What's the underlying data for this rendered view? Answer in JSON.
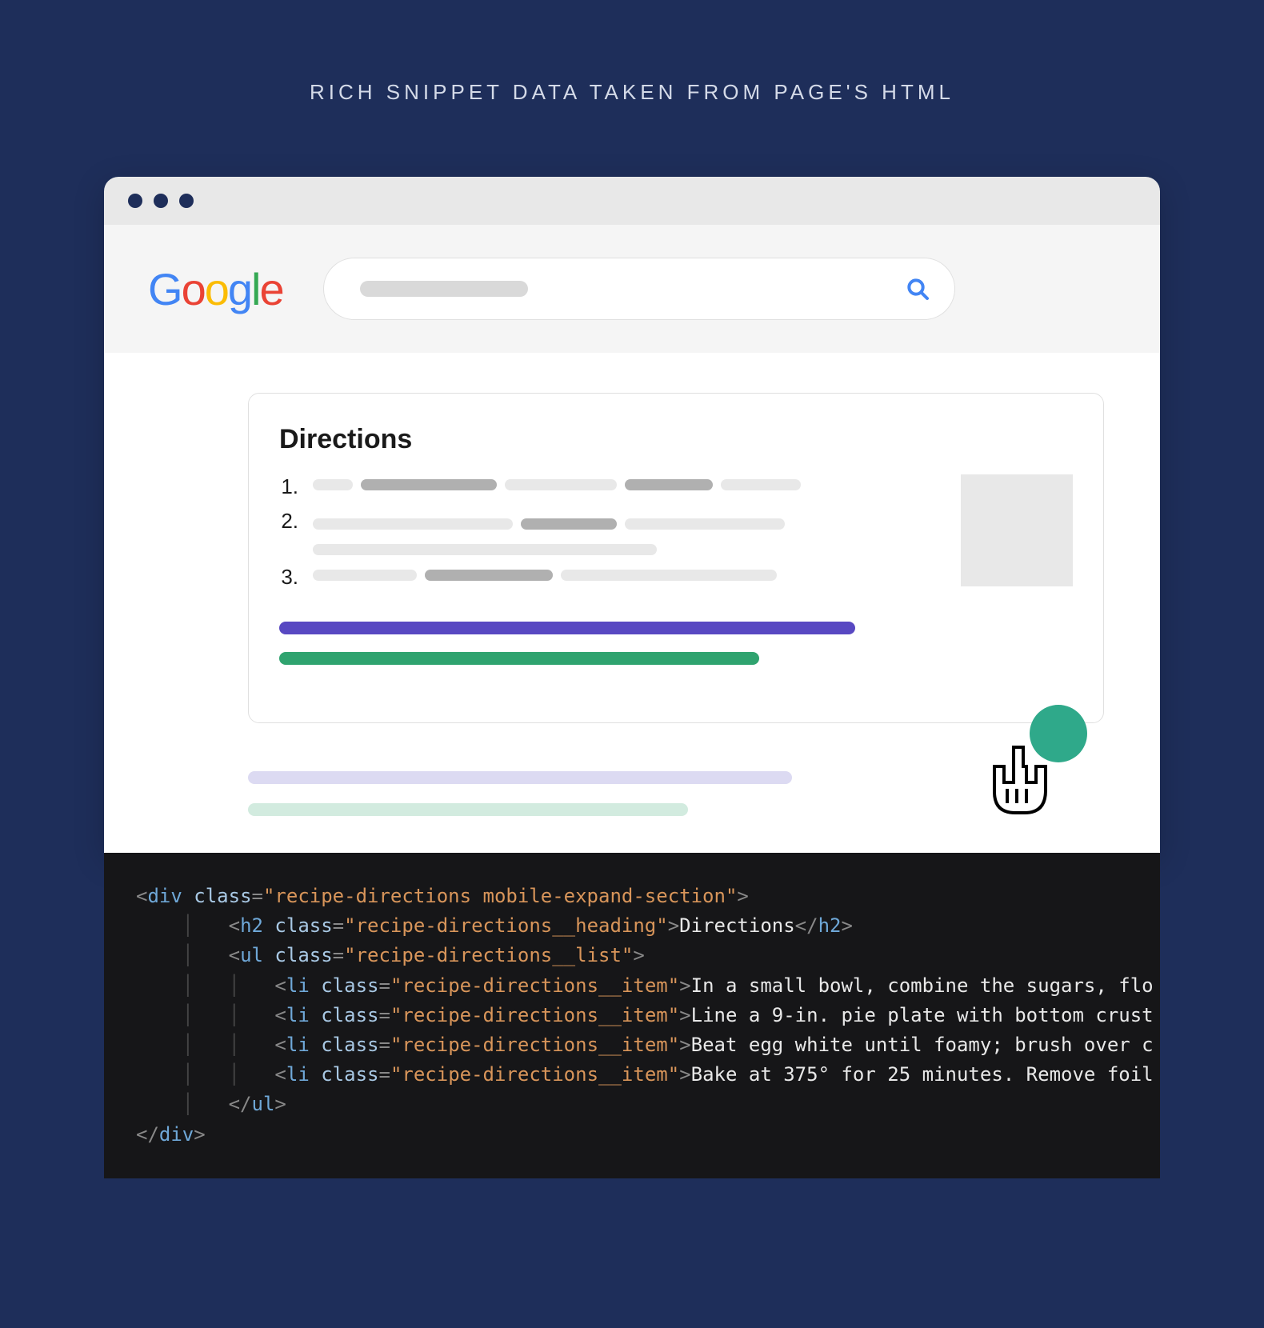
{
  "title": "RICH SNIPPET DATA TAKEN FROM PAGE'S HTML",
  "logo_letters": [
    "G",
    "o",
    "o",
    "g",
    "l",
    "e"
  ],
  "snippet": {
    "heading": "Directions",
    "items": [
      "1.",
      "2.",
      "3."
    ]
  },
  "code": {
    "div_open_class": "recipe-directions mobile-expand-section",
    "h2_class": "recipe-directions__heading",
    "h2_text": "Directions",
    "ul_class": "recipe-directions__list",
    "li_class": "recipe-directions__item",
    "li_texts": [
      "In a small bowl, combine the sugars, flo",
      "Line a 9-in. pie plate with bottom crust",
      "Beat egg white until foamy; brush over c",
      "Bake at 375° for 25 minutes. Remove foil"
    ]
  }
}
